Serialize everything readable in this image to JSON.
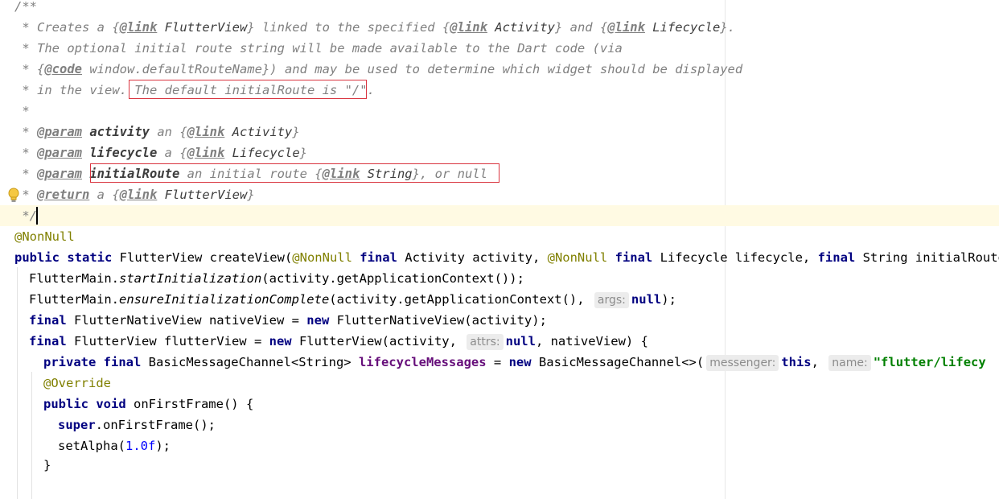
{
  "editor": {
    "lines": [
      {
        "text": "/**"
      },
      {
        "text": " * Creates a {@link FlutterView} linked to the specified {@link Activity} and {@link Lifecycle}."
      },
      {
        "text": " * The optional initial route string will be made available to the Dart code (via"
      },
      {
        "text": " * {@code window.defaultRouteName}) and may be used to determine which widget should be displayed"
      },
      {
        "text": " * in the view. The default initialRoute is \"/\"."
      },
      {
        "text": " *"
      },
      {
        "text": " * @param activity an {@link Activity}"
      },
      {
        "text": " * @param lifecycle a {@link Lifecycle}"
      },
      {
        "text": " * @param initialRoute an initial route {@link String}, or null"
      },
      {
        "text": " * @return a {@link FlutterView}"
      },
      {
        "text": " */"
      },
      {
        "text": "@NonNull"
      },
      {
        "text": "public static FlutterView createView(@NonNull final Activity activity, @NonNull final Lifecycle lifecycle, final String initialRoute)"
      },
      {
        "text": "  FlutterMain.startInitialization(activity.getApplicationContext());"
      },
      {
        "text": "  FlutterMain.ensureInitializationComplete(activity.getApplicationContext(), args: null);"
      },
      {
        "text": "  final FlutterNativeView nativeView = new FlutterNativeView(activity);"
      },
      {
        "text": "  final FlutterView flutterView = new FlutterView(activity, attrs: null, nativeView) {"
      },
      {
        "text": "    private final BasicMessageChannel<String> lifecycleMessages = new BasicMessageChannel<>( messenger: this, name: \"flutter/lifecy"
      },
      {
        "text": "    @Override"
      },
      {
        "text": "    public void onFirstFrame() {"
      },
      {
        "text": "      super.onFirstFrame();"
      },
      {
        "text": "      setAlpha(1.0f);"
      },
      {
        "text": "    }"
      }
    ],
    "hints": {
      "args": "args:",
      "attrs": "attrs:",
      "messenger": "messenger:",
      "name": "name:"
    },
    "current_line": 11,
    "gutter_icon": "lightbulb-icon",
    "highlight_color": "#d9343f"
  }
}
